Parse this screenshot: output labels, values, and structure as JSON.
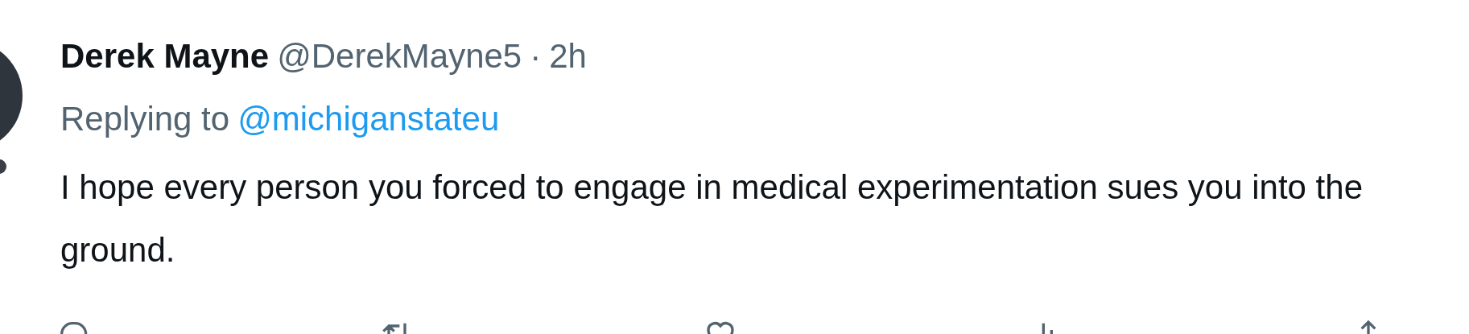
{
  "tweet": {
    "author_name": "Derek Mayne",
    "handle": "@DerekMayne5",
    "separator": "·",
    "time": "2h",
    "reply_prefix": "Replying to",
    "reply_handle": "@michiganstateu",
    "text": "I hope every person you forced to engage in medical experimentation sues you into the ground."
  },
  "actions": [
    {
      "kind": "reply"
    },
    {
      "kind": "retweet"
    },
    {
      "kind": "like"
    },
    {
      "kind": "views"
    },
    {
      "kind": "share"
    }
  ]
}
